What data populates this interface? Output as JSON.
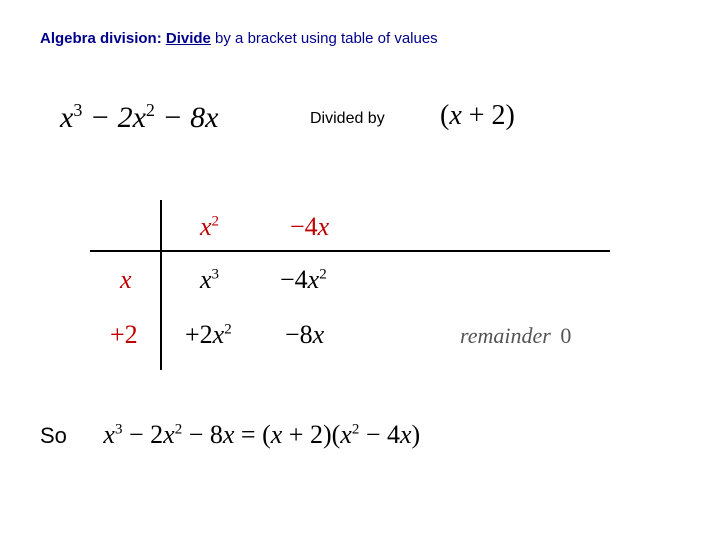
{
  "title": {
    "bold1": "Algebra division:",
    "bold2": "Divide",
    "rest": "by a bracket using table of values"
  },
  "expr": {
    "dividend_html": "x³ − 2x² − 8x",
    "divided_by": "Divided by",
    "divisor_html": "(x + 2)"
  },
  "table": {
    "header_col1": "x²",
    "header_col2": "−4x",
    "row1_label": "x",
    "row1_col1": "x³",
    "row1_col2": "−4x²",
    "row2_label": "+2",
    "row2_col1": "+2x²",
    "row2_col2": "−8x",
    "remainder_label": "remainder",
    "remainder_value": "0"
  },
  "result": {
    "so": "So",
    "equation": "x³ − 2x² − 8x = (x + 2)(x² − 4x)"
  }
}
